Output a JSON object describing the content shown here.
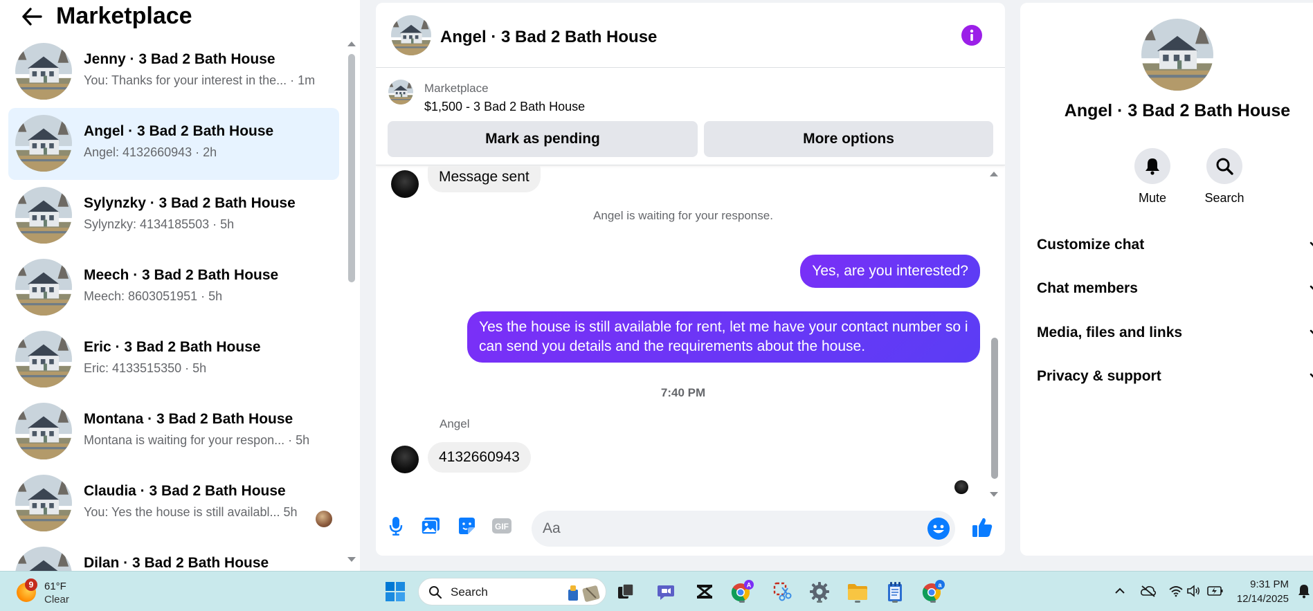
{
  "sidebar": {
    "title": "Marketplace",
    "conversations": [
      {
        "name": "Jenny · 3 Bad 2 Bath House",
        "snippet": "You: Thanks for your interest in the... · 1m"
      },
      {
        "name": "Angel · 3 Bad 2 Bath House",
        "snippet": "Angel: 4132660943 · 2h"
      },
      {
        "name": "Sylynzky · 3 Bad 2 Bath House",
        "snippet": "Sylynzky: 4134185503 · 5h"
      },
      {
        "name": "Meech · 3 Bad 2 Bath House",
        "snippet": "Meech: 8603051951 · 5h"
      },
      {
        "name": "Eric · 3 Bad 2 Bath House",
        "snippet": "Eric: 4133515350 · 5h"
      },
      {
        "name": "Montana · 3 Bad 2 Bath House",
        "snippet": "Montana is waiting for your respon... · 5h"
      },
      {
        "name": "Claudia · 3 Bad 2 Bath House",
        "snippet": "You: Yes the house is still availabl... 5h"
      },
      {
        "name": "Dilan · 3 Bad 2 Bath House",
        "snippet": ""
      }
    ]
  },
  "chat": {
    "title": "Angel · 3 Bad 2 Bath House",
    "listing": {
      "source": "Marketplace",
      "price_title": "$1,500 - 3 Bad 2 Bath House",
      "pending_label": "Mark as pending",
      "more_label": "More options"
    },
    "messages": {
      "first_in": "Message sent",
      "waiting_note": "Angel is waiting for your response.",
      "out_1": "Yes, are you interested?",
      "out_2": "Yes the house is still available for rent, let me have your contact number so i can send you details and the requirements about the house.",
      "timestamp": "7:40 PM",
      "sender": "Angel",
      "in_2": "4132660943"
    },
    "composer_placeholder": "Aa"
  },
  "info_panel": {
    "name": "Angel · 3 Bad 2 Bath House",
    "mute_label": "Mute",
    "search_label": "Search",
    "sections": [
      "Customize chat",
      "Chat members",
      "Media, files and links",
      "Privacy & support"
    ]
  },
  "taskbar": {
    "weather_badge": "9",
    "temp": "61°F",
    "condition": "Clear",
    "search_label": "Search",
    "time": "9:31 PM",
    "date": "12/14/2025"
  },
  "colors": {
    "accent_purple": "#9b1fe8",
    "bubble_out": "#6a35f6",
    "messenger_blue": "#0a7cff",
    "selected_row": "#e7f3ff"
  }
}
